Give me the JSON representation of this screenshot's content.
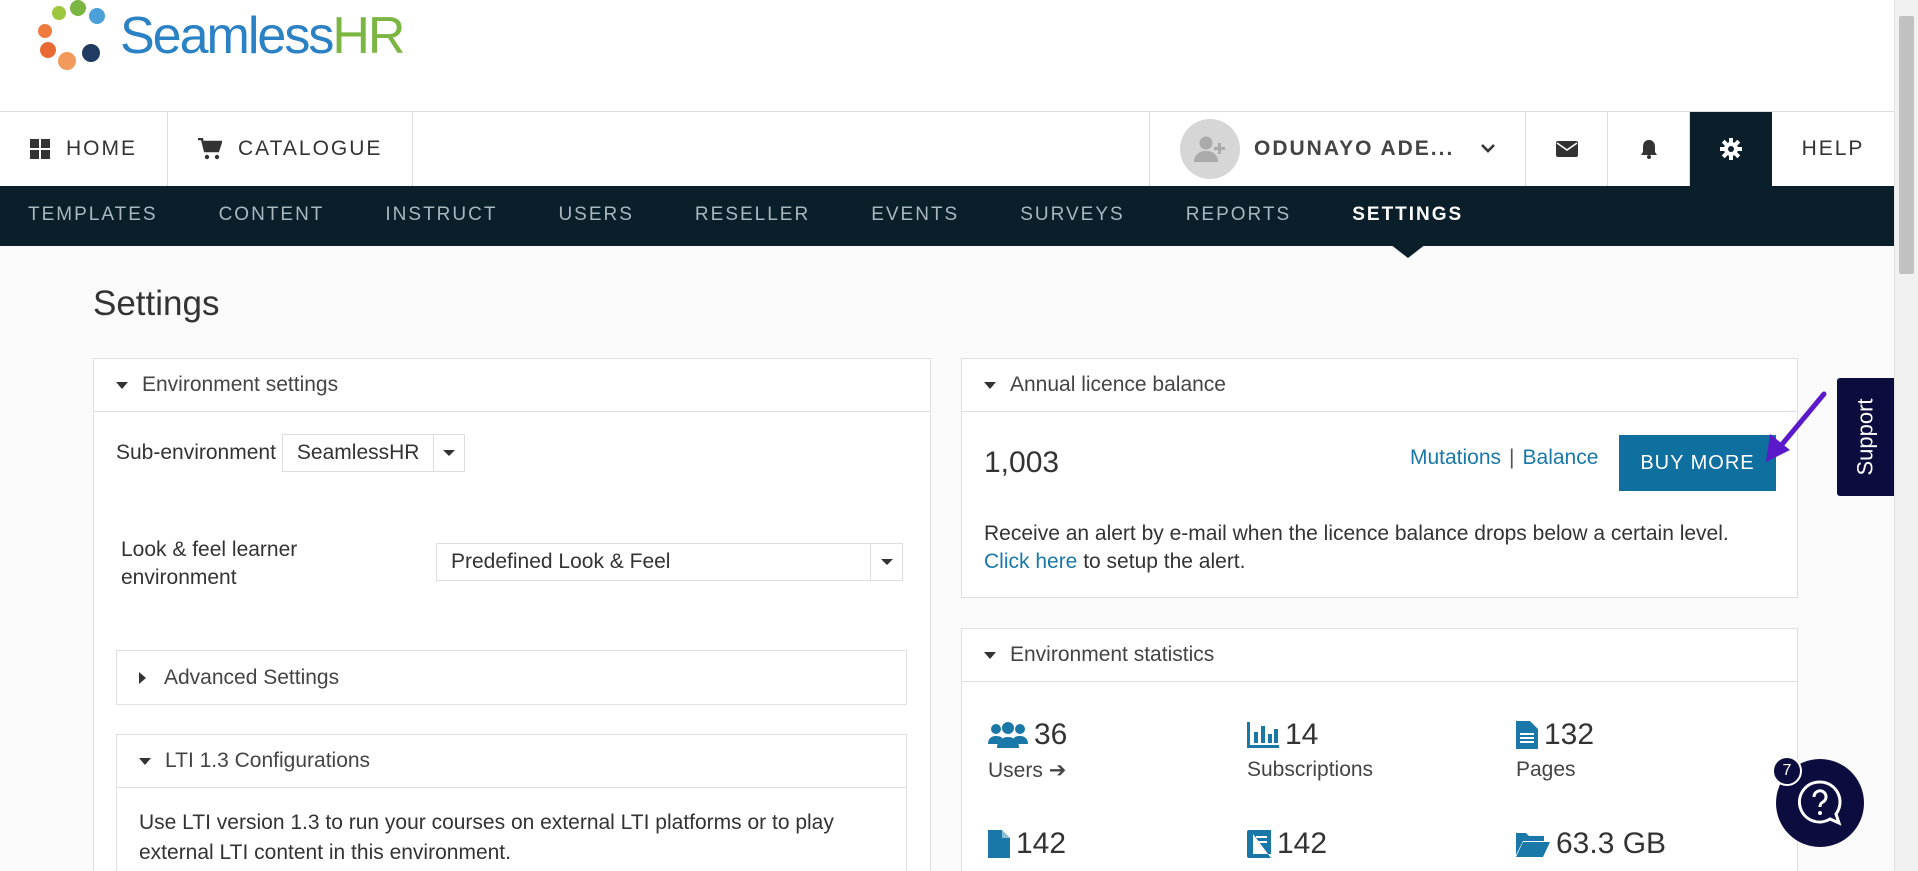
{
  "brand": {
    "name_part1": "Seamless",
    "name_part2": "HR"
  },
  "topnav": {
    "home": "HOME",
    "catalogue": "CATALOGUE",
    "user_name": "ODUNAYO ADE...",
    "help": "HELP"
  },
  "subnav": [
    "TEMPLATES",
    "CONTENT",
    "INSTRUCT",
    "USERS",
    "RESELLER",
    "EVENTS",
    "SURVEYS",
    "REPORTS",
    "SETTINGS"
  ],
  "page": {
    "title": "Settings"
  },
  "env_settings": {
    "title": "Environment settings",
    "sub_env_label": "Sub-environment",
    "sub_env_value": "SeamlessHR",
    "look_label": "Look & feel learner environment",
    "look_value": "Predefined Look & Feel",
    "advanced": "Advanced Settings",
    "lti_title": "LTI 1.3 Configurations",
    "lti_text": "Use LTI version 1.3 to run your courses on external LTI platforms or to play external LTI content in this environment."
  },
  "licence": {
    "title": "Annual licence balance",
    "balance_value": "1,003",
    "mutations": "Mutations",
    "separator": "|",
    "balance_link": "Balance",
    "buy_more": "BUY MORE",
    "alert_text": "Receive an alert by e-mail when the licence balance drops below a certain level.",
    "click_here": "Click here",
    "alert_text2": " to setup the alert."
  },
  "stats": {
    "title": "Environment statistics",
    "users_num": "36",
    "users_label": "Users",
    "subs_num": "14",
    "subs_label": "Subscriptions",
    "pages_num": "132",
    "pages_label": "Pages",
    "docs_num": "142",
    "books_num": "142",
    "storage_num": "63.3 GB"
  },
  "widgets": {
    "support": "Support",
    "badge": "7"
  },
  "colors": {
    "nav_dark": "#0a1f2a",
    "link": "#1a78a8",
    "button": "#0f6f9e",
    "support": "#0c0c3e",
    "annotation_arrow": "#5b19c9"
  }
}
